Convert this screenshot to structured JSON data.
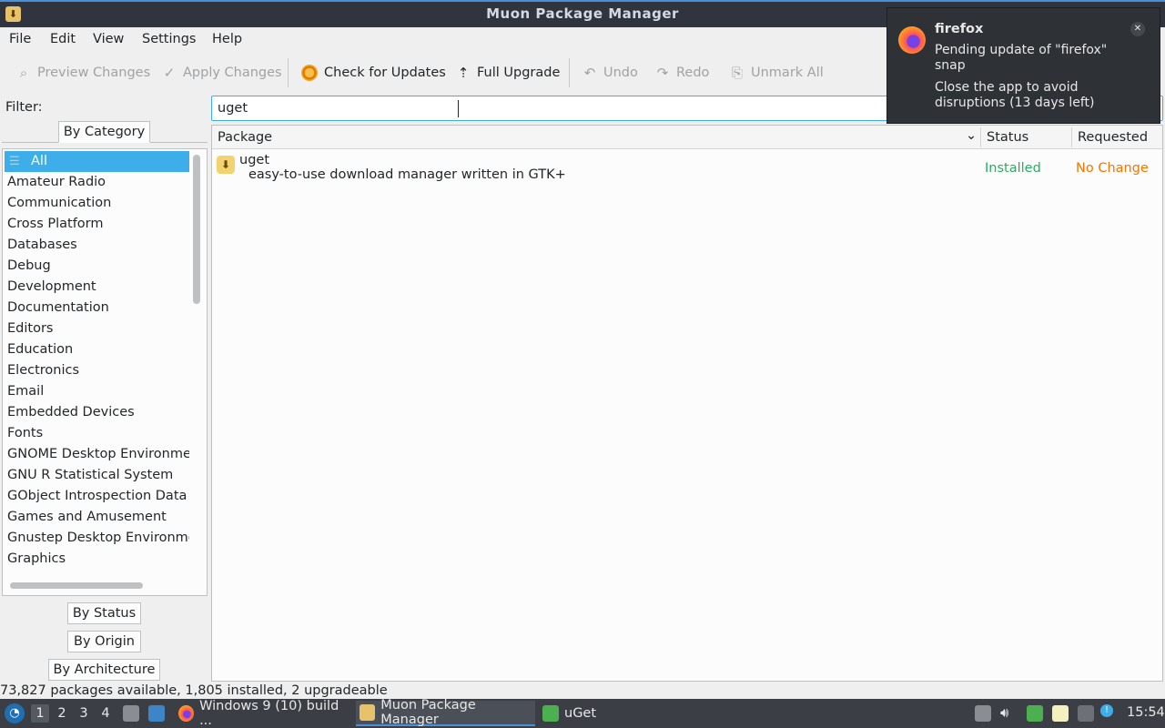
{
  "window": {
    "title": "Muon Package Manager"
  },
  "menu": [
    "File",
    "Edit",
    "View",
    "Settings",
    "Help"
  ],
  "toolbar": {
    "preview": "Preview Changes",
    "apply": "Apply Changes",
    "check": "Check for Updates",
    "upgrade": "Full Upgrade",
    "undo": "Undo",
    "redo": "Redo",
    "unmark": "Unmark All"
  },
  "filter": {
    "label": "Filter:",
    "value": "uget"
  },
  "tabs": {
    "category": "By Category",
    "status": "By Status",
    "origin": "By Origin",
    "architecture": "By Architecture"
  },
  "categories": [
    "All",
    "Amateur Radio",
    "Communication",
    "Cross Platform",
    "Databases",
    "Debug",
    "Development",
    "Documentation",
    "Editors",
    "Education",
    "Electronics",
    "Email",
    "Embedded Devices",
    "Fonts",
    "GNOME Desktop Environment",
    "GNU R Statistical System",
    "GObject Introspection Data",
    "Games and Amusement",
    "Gnustep Desktop Environment",
    "Graphics"
  ],
  "table": {
    "headers": {
      "package": "Package",
      "status": "Status",
      "requested": "Requested"
    },
    "rows": [
      {
        "name": "uget",
        "description": "easy-to-use download manager written in GTK+",
        "status": "Installed",
        "requested": "No Change"
      }
    ]
  },
  "statusbar": "73,827 packages available, 1,805 installed, 2 upgradeable",
  "taskbar": {
    "workspaces": [
      "1",
      "2",
      "3",
      "4"
    ],
    "apps": [
      "Windows 9 (10) build ...",
      "Muon Package Manager",
      "uGet"
    ],
    "clock": "15:54"
  },
  "notification": {
    "app": "firefox",
    "line1": "Pending update of \"firefox\" snap",
    "line2": "Close the app to avoid disruptions (13 days left)"
  },
  "colors": {
    "accent": "#3daee9",
    "installed": "#27ae60",
    "no_change": "#f67400",
    "titlebar": "#2f343f",
    "taskbar": "#3b3f45"
  }
}
